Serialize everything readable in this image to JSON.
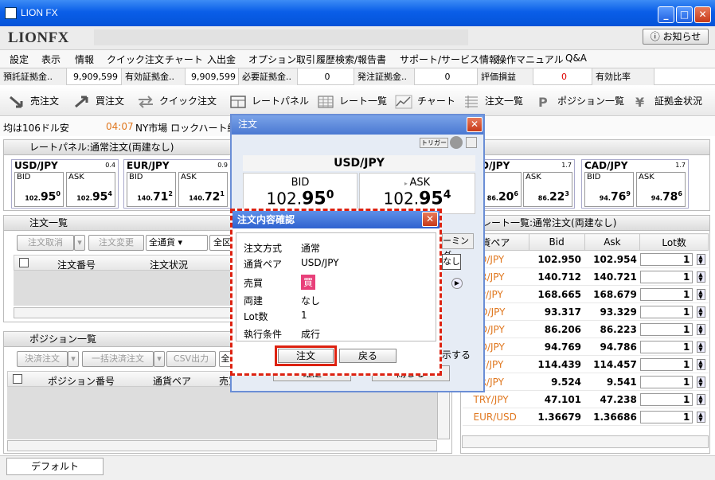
{
  "window": {
    "title": "LION FX"
  },
  "logo": "LIONFX",
  "notice_button": "お知らせ",
  "menu": [
    "設定",
    "表示",
    "情報",
    "クイック注文",
    "チャート",
    "入出金",
    "オプション取引",
    "履歴検索/報告書",
    "サポート/サービス情報",
    "操作マニュアル",
    "Q&A"
  ],
  "info": {
    "l1": "預託証拠金..",
    "v1": "9,909,599",
    "l2": "有効証拠金..",
    "v2": "9,909,599",
    "l3": "必要証拠金..",
    "v3": "0",
    "l4": "発注証拠金..",
    "v4": "0",
    "l5": "評価損益",
    "v5": "0",
    "l6": "有効比率"
  },
  "toolbar": [
    "売注文",
    "買注文",
    "クイック注文",
    "レートパネル",
    "レート一覧",
    "チャート",
    "注文一覧",
    "ポジション一覧",
    "証拠金状況"
  ],
  "ticker": {
    "text": "均は106ドル安",
    "time": "04:07",
    "text2": "NY市場 ロックハート総"
  },
  "rate_panel": {
    "title": "レートパネル:通常注文(両建なし)",
    "cards": [
      {
        "pair": "USD/JPY",
        "spread": "0.4",
        "bid_small": "102.",
        "bid_big": "95",
        "bid_frac": "0",
        "ask_small": "102.",
        "ask_big": "95",
        "ask_frac": "4"
      },
      {
        "pair": "EUR/JPY",
        "spread": "0.9",
        "bid_small": "140.",
        "bid_big": "71",
        "bid_frac": "2",
        "ask_small": "140.",
        "ask_big": "72",
        "ask_frac": "1"
      },
      {
        "pair": "D/JPY",
        "spread": "1.7",
        "bid_small": "86.",
        "bid_big": "20",
        "bid_frac": "6",
        "ask_small": "86.",
        "ask_big": "22",
        "ask_frac": "3"
      },
      {
        "pair": "CAD/JPY",
        "spread": "1.7",
        "bid_small": "94.",
        "bid_big": "76",
        "bid_frac": "9",
        "ask_small": "94.",
        "ask_big": "78",
        "ask_frac": "6"
      }
    ],
    "bid_label": "BID",
    "ask_label": "ASK"
  },
  "order_list": {
    "title": "注文一覧",
    "btn_cancel": "注文取消",
    "btn_change": "注文変更",
    "select_all": "全通貨",
    "select2": "全区",
    "col_no": "注文番号",
    "col_status": "注文状況"
  },
  "position_list": {
    "title": "ポジション一覧",
    "btn_settle": "決済注文",
    "btn_bulk": "一括決済注文",
    "btn_csv": "CSV出力",
    "select1": "全",
    "col_no": "ポジション番号",
    "col_pair": "通貨ペア",
    "col_trade": "売買"
  },
  "rate_list": {
    "title": "レート一覧:通常注文(両建なし)",
    "col_pair": "貨ペア",
    "col_bid": "Bid",
    "col_ask": "Ask",
    "col_lot": "Lot数",
    "rows": [
      {
        "pair": "SD/JPY",
        "bid": "102.950",
        "ask": "102.954",
        "lot": "1"
      },
      {
        "pair": "UR/JPY",
        "bid": "140.712",
        "ask": "140.721",
        "lot": "1"
      },
      {
        "pair": "BP/JPY",
        "bid": "168.665",
        "ask": "168.679",
        "lot": "1"
      },
      {
        "pair": "UD/JPY",
        "bid": "93.317",
        "ask": "93.329",
        "lot": "1"
      },
      {
        "pair": "ZD/JPY",
        "bid": "86.206",
        "ask": "86.223",
        "lot": "1"
      },
      {
        "pair": "AD/JPY",
        "bid": "94.769",
        "ask": "94.786",
        "lot": "1"
      },
      {
        "pair": "HF/JPY",
        "bid": "114.439",
        "ask": "114.457",
        "lot": "1"
      },
      {
        "pair": "AR/JPY",
        "bid": "9.524",
        "ask": "9.541",
        "lot": "1"
      },
      {
        "pair": "TRY/JPY",
        "bid": "47.101",
        "ask": "47.238",
        "lot": "1"
      },
      {
        "pair": "EUR/USD",
        "bid": "1.36679",
        "ask": "1.36686",
        "lot": "1"
      }
    ]
  },
  "order_dialog": {
    "title": "注文",
    "trigger": "トリガー",
    "pair": "USD/JPY",
    "bid_label": "BID",
    "ask_label": "ASK",
    "bid_small": "102.",
    "bid_big": "95",
    "bid_frac": "0",
    "ask_small": "102.",
    "ask_big": "95",
    "ask_frac": "4",
    "right_tab": "ーミング",
    "right_none": "なし",
    "right_show": "示する",
    "btn_a": "確定",
    "btn_b": "閉じる"
  },
  "confirm_dialog": {
    "title": "注文内容確認",
    "labels": [
      "注文方式",
      "通貨ペア",
      "売買",
      "両建",
      "Lot数",
      "執行条件"
    ],
    "values": [
      "通常",
      "USD/JPY",
      "買",
      "なし",
      "1",
      "成行"
    ],
    "btn_order": "注文",
    "btn_back": "戻る"
  },
  "status": {
    "tab": "デフォルト"
  },
  "colors": {
    "accent": "#0a5ee8",
    "buy_badge": "#e8407a",
    "highlight": "#d21"
  }
}
